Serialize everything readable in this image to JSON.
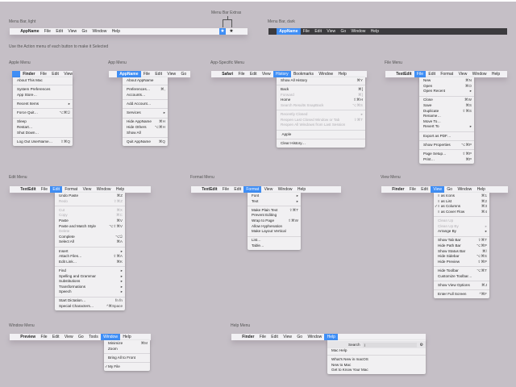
{
  "labels": {
    "menu_bar_light": "Menu Bar, light",
    "menu_bar_extras": "Menu Bar Extras",
    "menu_bar_dark": "Menu Bar, dark",
    "hint": "Use the Action menu of each button to make it Selected"
  },
  "light_bar": {
    "items": [
      "AppName",
      "File",
      "Edit",
      "View",
      "Go",
      "Window",
      "Help"
    ],
    "extras_icons": [
      "star-icon",
      "star-icon"
    ]
  },
  "dark_bar": {
    "items": [
      "AppName",
      "File",
      "Edit",
      "View",
      "Go",
      "Window",
      "Help"
    ]
  },
  "menus": [
    {
      "title": "Apple Menu",
      "bar": [
        "Finder",
        "File",
        "Edit",
        "View"
      ],
      "selected": -1,
      "items": [
        {
          "label": "About This Mac"
        },
        {
          "sep": true
        },
        {
          "label": "System Preferences"
        },
        {
          "label": "App Store…"
        },
        {
          "sep": true
        },
        {
          "label": "Recent Items",
          "submenu": true
        },
        {
          "sep": true
        },
        {
          "label": "Force Quit…",
          "shortcut": "⌥⌘⎋"
        },
        {
          "sep": true
        },
        {
          "label": "Sleep"
        },
        {
          "label": "Restart…"
        },
        {
          "label": "Shut Down…"
        },
        {
          "sep": true
        },
        {
          "label": "Log Out UserName…",
          "shortcut": "⇧⌘Q"
        }
      ]
    },
    {
      "title": "App Menu",
      "bar": [
        "AppName",
        "File",
        "Edit",
        "View",
        "Go"
      ],
      "selected": 0,
      "items": [
        {
          "label": "About AppName"
        },
        {
          "sep": true
        },
        {
          "label": "Preferences…",
          "shortcut": "⌘,"
        },
        {
          "label": "Accounts…"
        },
        {
          "sep": true
        },
        {
          "label": "Add Account…"
        },
        {
          "sep": true
        },
        {
          "label": "Services",
          "submenu": true
        },
        {
          "sep": true
        },
        {
          "label": "Hide AppName",
          "shortcut": "⌘H"
        },
        {
          "label": "Hide Others",
          "shortcut": "⌥⌘H"
        },
        {
          "label": "Show All"
        },
        {
          "sep": true
        },
        {
          "label": "Quit AppName",
          "shortcut": "⌘Q"
        }
      ]
    },
    {
      "title": "App-Specific Menu",
      "bar": [
        "Safari",
        "File",
        "Edit",
        "View",
        "History",
        "Bookmarks",
        "Window",
        "Help"
      ],
      "selected": 4,
      "items": [
        {
          "label": "Show All History",
          "shortcut": "⌘Y"
        },
        {
          "sep": true
        },
        {
          "label": "Back",
          "shortcut": "⌘["
        },
        {
          "label": "Forward",
          "shortcut": "⌘]",
          "disabled": true
        },
        {
          "label": "Home",
          "shortcut": "⇧⌘H"
        },
        {
          "label": "Search Results SnapBack",
          "shortcut": "⌥⌘S",
          "disabled": true
        },
        {
          "sep": true
        },
        {
          "label": "Recently Closed",
          "submenu": true,
          "disabled": true
        },
        {
          "label": "Reopen Last Closed Window or Tab",
          "shortcut": "⇧⌘T",
          "disabled": true
        },
        {
          "label": "Reopen All Windows from Last Session",
          "disabled": true
        },
        {
          "sep": true
        },
        {
          "label": "Apple",
          "icon": ""
        },
        {
          "sep": true
        },
        {
          "label": "Clear History…"
        }
      ]
    },
    {
      "title": "File Menu",
      "bar": [
        "TextEdit",
        "File",
        "Edit",
        "Format",
        "View",
        "Window",
        "Help"
      ],
      "selected": 1,
      "items": [
        {
          "label": "New",
          "shortcut": "⌘N"
        },
        {
          "label": "Open",
          "shortcut": "⌘O"
        },
        {
          "label": "Open Recent",
          "submenu": true
        },
        {
          "sep": true
        },
        {
          "label": "Close",
          "shortcut": "⌘W"
        },
        {
          "label": "Save",
          "shortcut": "⌘S"
        },
        {
          "label": "Duplicate",
          "shortcut": "⇧⌘S"
        },
        {
          "label": "Rename…"
        },
        {
          "label": "Move To…"
        },
        {
          "label": "Revert To",
          "submenu": true
        },
        {
          "sep": true
        },
        {
          "label": "Export as PDF…"
        },
        {
          "sep": true
        },
        {
          "label": "Show Properties",
          "shortcut": "⌥⌘P"
        },
        {
          "sep": true
        },
        {
          "label": "Page Setup…",
          "shortcut": "⇧⌘P"
        },
        {
          "label": "Print…",
          "shortcut": "⌘P"
        }
      ]
    },
    {
      "title": "Edit Menu",
      "bar": [
        "TextEdit",
        "File",
        "Edit",
        "Format",
        "View",
        "Window",
        "Help"
      ],
      "selected": 2,
      "items": [
        {
          "label": "Undo Paste",
          "shortcut": "⌘Z"
        },
        {
          "label": "Redo",
          "shortcut": "⇧⌘Z",
          "disabled": true
        },
        {
          "sep": true
        },
        {
          "label": "Cut",
          "shortcut": "⌘X",
          "disabled": true
        },
        {
          "label": "Copy",
          "shortcut": "⌘C",
          "disabled": true
        },
        {
          "label": "Paste",
          "shortcut": "⌘V"
        },
        {
          "label": "Paste and Match Style",
          "shortcut": "⌥⇧⌘V"
        },
        {
          "label": "Delete",
          "disabled": true
        },
        {
          "label": "Complete",
          "shortcut": "⌥⎋"
        },
        {
          "label": "Select All",
          "shortcut": "⌘A"
        },
        {
          "sep": true
        },
        {
          "label": "Insert",
          "submenu": true
        },
        {
          "label": "Attach Files…",
          "shortcut": "⇧⌘A"
        },
        {
          "label": "Edit Link…",
          "shortcut": "⌘K"
        },
        {
          "sep": true
        },
        {
          "label": "Find",
          "submenu": true
        },
        {
          "label": "Spelling and Grammar",
          "submenu": true
        },
        {
          "label": "Substitutions",
          "submenu": true
        },
        {
          "label": "Transformations",
          "submenu": true
        },
        {
          "label": "Speech",
          "submenu": true
        },
        {
          "sep": true
        },
        {
          "label": "Start Dictation…",
          "shortcut": "fn fn"
        },
        {
          "label": "Special Characters…",
          "shortcut": "^⌘Space"
        }
      ]
    },
    {
      "title": "Format Menu",
      "bar": [
        "TextEdit",
        "File",
        "Edit",
        "Format",
        "View",
        "Window",
        "Help"
      ],
      "selected": 3,
      "items": [
        {
          "label": "Font",
          "submenu": true
        },
        {
          "label": "Text",
          "submenu": true
        },
        {
          "sep": true
        },
        {
          "label": "Make Plain Text",
          "shortcut": "⇧⌘T"
        },
        {
          "label": "Prevent Editing"
        },
        {
          "label": "Wrap to Page",
          "shortcut": "⇧⌘W"
        },
        {
          "label": "Allow Hyphenation"
        },
        {
          "label": "Make Layout Vertical"
        },
        {
          "sep": true
        },
        {
          "label": "List…"
        },
        {
          "label": "Table…"
        }
      ]
    },
    {
      "title": "View Menu",
      "bar": [
        "Finder",
        "File",
        "Edit",
        "View",
        "Go",
        "Window",
        "Help"
      ],
      "selected": 3,
      "items": [
        {
          "label": "as Icons",
          "shortcut": "⌘1",
          "icon": "≡"
        },
        {
          "label": "as List",
          "shortcut": "⌘2",
          "icon": "≡"
        },
        {
          "label": "as Columns",
          "shortcut": "⌘3",
          "icon": "≡",
          "check": true
        },
        {
          "label": "as Cover Flow",
          "shortcut": "⌘4",
          "icon": "≡"
        },
        {
          "sep": true
        },
        {
          "label": "Clean Up",
          "disabled": true
        },
        {
          "label": "Clean Up By",
          "submenu": true,
          "disabled": true
        },
        {
          "label": "Arrange By",
          "submenu": true
        },
        {
          "sep": true
        },
        {
          "label": "Show Tab Bar",
          "shortcut": "⇧⌘T"
        },
        {
          "label": "Hide Path Bar",
          "shortcut": "⌥⌘P"
        },
        {
          "label": "Show Status Bar",
          "shortcut": "⌘/"
        },
        {
          "label": "Hide Sidebar",
          "shortcut": "⌥⌘S"
        },
        {
          "label": "Hide Preview",
          "shortcut": "⇧⌘P"
        },
        {
          "sep": true
        },
        {
          "label": "Hide Toolbar",
          "shortcut": "⌥⌘T"
        },
        {
          "label": "Customize Toolbar…"
        },
        {
          "sep": true
        },
        {
          "label": "Show View Options",
          "shortcut": "⌘J"
        },
        {
          "sep": true
        },
        {
          "label": "Enter Full Screen",
          "shortcut": "^⌘F"
        }
      ]
    },
    {
      "title": "Window Menu",
      "bar": [
        "Preview",
        "File",
        "Edit",
        "View",
        "Go",
        "Tools",
        "Window",
        "Help"
      ],
      "selected": 6,
      "items": [
        {
          "label": "Minimize",
          "shortcut": "⌘M"
        },
        {
          "label": "Zoom"
        },
        {
          "sep": true
        },
        {
          "label": "Bring All to Front"
        },
        {
          "sep": true
        },
        {
          "label": "My File",
          "check": true
        }
      ]
    },
    {
      "title": "Help Menu",
      "bar": [
        "Finder",
        "File",
        "Edit",
        "View",
        "Go",
        "Window",
        "Help"
      ],
      "selected": 6,
      "items": [
        {
          "search": true,
          "label": "Search"
        },
        {
          "label": "Mac Help"
        },
        {
          "sep": true
        },
        {
          "label": "What's New in macOS"
        },
        {
          "label": "New to Mac"
        },
        {
          "label": "Get to Know Your Mac"
        }
      ]
    }
  ],
  "colors": {
    "accent": "#3f8ef5",
    "background": "#c5bfc6",
    "menu_bg": "#f1f0f2",
    "dark_bar": "#3c3b3e"
  }
}
